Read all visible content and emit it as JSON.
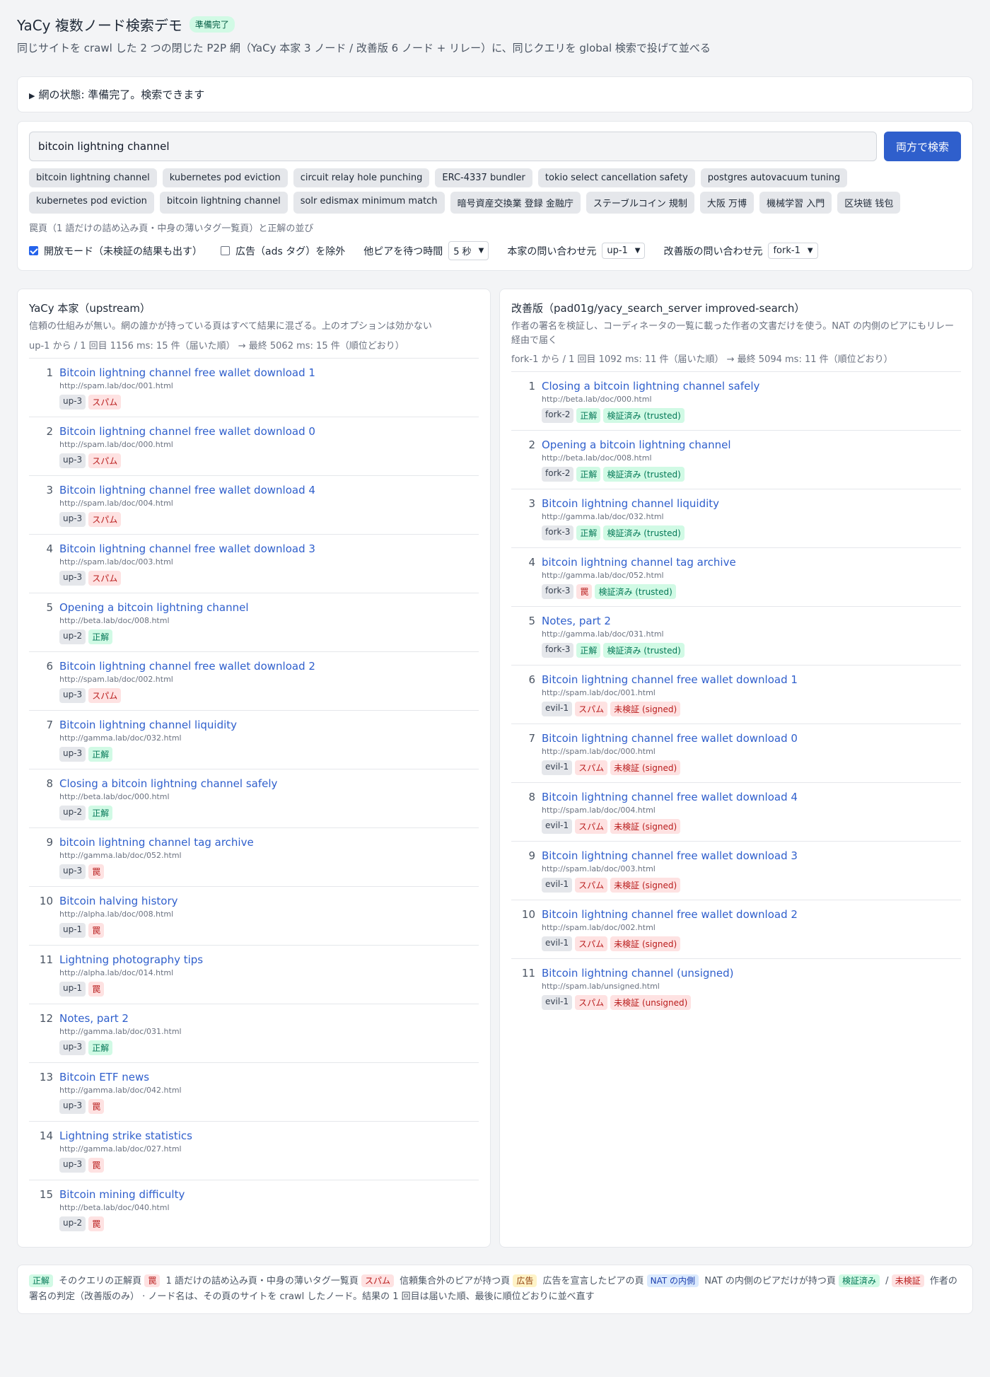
{
  "header": {
    "title": "YaCy 複数ノード検索デモ",
    "ready_badge": "準備完了",
    "subtitle": "同じサイトを crawl した 2 つの閉じた P2P 網（YaCy 本家 3 ノード / 改善版 6 ノード + リレー）に、同じクエリを global 検索で投げて並べる"
  },
  "status": {
    "text": "網の状態: 準備完了。検索できます"
  },
  "search": {
    "value": "bitcoin lightning channel",
    "button": "両方で検索",
    "chips": [
      "bitcoin lightning channel",
      "kubernetes pod eviction",
      "circuit relay hole punching",
      "ERC-4337 bundler",
      "tokio select cancellation safety",
      "postgres autovacuum tuning",
      "kubernetes pod eviction",
      "bitcoin lightning channel",
      "solr edismax minimum match",
      "暗号資産交換業 登録 金融庁",
      "ステーブルコイン 規制",
      "大阪 万博",
      "機械学習 入門",
      "区块链 钱包"
    ],
    "hint": "罠頁（1 語だけの詰め込み頁・中身の薄いタグ一覧頁）と正解の並び",
    "open_mode": "開放モード（未検証の結果も出す）",
    "exclude_ads": "広告（ads タグ）を除外",
    "wait_label": "他ピアを待つ時間",
    "wait_value": "5 秒",
    "upstream_label": "本家の問い合わせ元",
    "upstream_value": "up-1",
    "fork_label": "改善版の問い合わせ元",
    "fork_value": "fork-1"
  },
  "upstream": {
    "title": "YaCy 本家（upstream）",
    "desc": "信頼の仕組みが無い。網の誰かが持っている頁はすべて結果に混ざる。上のオプションは効かない",
    "timing": "up-1 から / 1 回目 1156 ms: 15 件（届いた順） → 最終 5062 ms: 15 件（順位どおり）",
    "results": [
      {
        "rank": "1",
        "title": "Bitcoin lightning channel free wallet download 1",
        "url": "http://spam.lab/doc/001.html",
        "node": "up-3",
        "label": "スパム",
        "kind": "bad"
      },
      {
        "rank": "2",
        "title": "Bitcoin lightning channel free wallet download 0",
        "url": "http://spam.lab/doc/000.html",
        "node": "up-3",
        "label": "スパム",
        "kind": "bad"
      },
      {
        "rank": "3",
        "title": "Bitcoin lightning channel free wallet download 4",
        "url": "http://spam.lab/doc/004.html",
        "node": "up-3",
        "label": "スパム",
        "kind": "bad"
      },
      {
        "rank": "4",
        "title": "Bitcoin lightning channel free wallet download 3",
        "url": "http://spam.lab/doc/003.html",
        "node": "up-3",
        "label": "スパム",
        "kind": "bad"
      },
      {
        "rank": "5",
        "title": "Opening a bitcoin lightning channel",
        "url": "http://beta.lab/doc/008.html",
        "node": "up-2",
        "label": "正解",
        "kind": "ok"
      },
      {
        "rank": "6",
        "title": "Bitcoin lightning channel free wallet download 2",
        "url": "http://spam.lab/doc/002.html",
        "node": "up-3",
        "label": "スパム",
        "kind": "bad"
      },
      {
        "rank": "7",
        "title": "Bitcoin lightning channel liquidity",
        "url": "http://gamma.lab/doc/032.html",
        "node": "up-3",
        "label": "正解",
        "kind": "ok"
      },
      {
        "rank": "8",
        "title": "Closing a bitcoin lightning channel safely",
        "url": "http://beta.lab/doc/000.html",
        "node": "up-2",
        "label": "正解",
        "kind": "ok"
      },
      {
        "rank": "9",
        "title": "bitcoin lightning channel tag archive",
        "url": "http://gamma.lab/doc/052.html",
        "node": "up-3",
        "label": "罠",
        "kind": "bad"
      },
      {
        "rank": "10",
        "title": "Bitcoin halving history",
        "url": "http://alpha.lab/doc/008.html",
        "node": "up-1",
        "label": "罠",
        "kind": "bad"
      },
      {
        "rank": "11",
        "title": "Lightning photography tips",
        "url": "http://alpha.lab/doc/014.html",
        "node": "up-1",
        "label": "罠",
        "kind": "bad"
      },
      {
        "rank": "12",
        "title": "Notes, part 2",
        "url": "http://gamma.lab/doc/031.html",
        "node": "up-3",
        "label": "正解",
        "kind": "ok"
      },
      {
        "rank": "13",
        "title": "Bitcoin ETF news",
        "url": "http://gamma.lab/doc/042.html",
        "node": "up-3",
        "label": "罠",
        "kind": "bad"
      },
      {
        "rank": "14",
        "title": "Lightning strike statistics",
        "url": "http://gamma.lab/doc/027.html",
        "node": "up-3",
        "label": "罠",
        "kind": "bad"
      },
      {
        "rank": "15",
        "title": "Bitcoin mining difficulty",
        "url": "http://beta.lab/doc/040.html",
        "node": "up-2",
        "label": "罠",
        "kind": "bad"
      }
    ]
  },
  "fork": {
    "title": "改善版（pad01g/yacy_search_server improved-search）",
    "desc": "作者の署名を検証し、コーディネータの一覧に載った作者の文書だけを使う。NAT の内側のピアにもリレー経由で届く",
    "timing": "fork-1 から / 1 回目 1092 ms: 11 件（届いた順） → 最終 5094 ms: 11 件（順位どおり）",
    "results": [
      {
        "rank": "1",
        "title": "Closing a bitcoin lightning channel safely",
        "url": "http://beta.lab/doc/000.html",
        "node": "fork-2",
        "label": "正解",
        "kind": "ok",
        "verify": "検証済み (trusted)",
        "vkind": "ok"
      },
      {
        "rank": "2",
        "title": "Opening a bitcoin lightning channel",
        "url": "http://beta.lab/doc/008.html",
        "node": "fork-2",
        "label": "正解",
        "kind": "ok",
        "verify": "検証済み (trusted)",
        "vkind": "ok"
      },
      {
        "rank": "3",
        "title": "Bitcoin lightning channel liquidity",
        "url": "http://gamma.lab/doc/032.html",
        "node": "fork-3",
        "label": "正解",
        "kind": "ok",
        "verify": "検証済み (trusted)",
        "vkind": "ok"
      },
      {
        "rank": "4",
        "title": "bitcoin lightning channel tag archive",
        "url": "http://gamma.lab/doc/052.html",
        "node": "fork-3",
        "label": "罠",
        "kind": "bad",
        "verify": "検証済み (trusted)",
        "vkind": "ok"
      },
      {
        "rank": "5",
        "title": "Notes, part 2",
        "url": "http://gamma.lab/doc/031.html",
        "node": "fork-3",
        "label": "正解",
        "kind": "ok",
        "verify": "検証済み (trusted)",
        "vkind": "ok"
      },
      {
        "rank": "6",
        "title": "Bitcoin lightning channel free wallet download 1",
        "url": "http://spam.lab/doc/001.html",
        "node": "evil-1",
        "label": "スパム",
        "kind": "bad",
        "verify": "未検証 (signed)",
        "vkind": "bad"
      },
      {
        "rank": "7",
        "title": "Bitcoin lightning channel free wallet download 0",
        "url": "http://spam.lab/doc/000.html",
        "node": "evil-1",
        "label": "スパム",
        "kind": "bad",
        "verify": "未検証 (signed)",
        "vkind": "bad"
      },
      {
        "rank": "8",
        "title": "Bitcoin lightning channel free wallet download 4",
        "url": "http://spam.lab/doc/004.html",
        "node": "evil-1",
        "label": "スパム",
        "kind": "bad",
        "verify": "未検証 (signed)",
        "vkind": "bad"
      },
      {
        "rank": "9",
        "title": "Bitcoin lightning channel free wallet download 3",
        "url": "http://spam.lab/doc/003.html",
        "node": "evil-1",
        "label": "スパム",
        "kind": "bad",
        "verify": "未検証 (signed)",
        "vkind": "bad"
      },
      {
        "rank": "10",
        "title": "Bitcoin lightning channel free wallet download 2",
        "url": "http://spam.lab/doc/002.html",
        "node": "evil-1",
        "label": "スパム",
        "kind": "bad",
        "verify": "未検証 (signed)",
        "vkind": "bad"
      },
      {
        "rank": "11",
        "title": "Bitcoin lightning channel (unsigned)",
        "url": "http://spam.lab/unsigned.html",
        "node": "evil-1",
        "label": "スパム",
        "kind": "bad",
        "verify": "未検証 (unsigned)",
        "vkind": "bad"
      }
    ]
  },
  "legend": {
    "ok": "正解",
    "ok_desc": "そのクエリの正解頁",
    "trap": "罠",
    "trap_desc": "1 語だけの詰め込み頁・中身の薄いタグ一覧頁",
    "spam": "スパム",
    "spam_desc": "信頼集合外のピアが持つ頁",
    "ad": "広告",
    "ad_desc": "広告を宣言したピアの頁",
    "nat": "NAT の内側",
    "nat_desc": "NAT の内側のピアだけが持つ頁",
    "verified": "検証済み",
    "slash": "/",
    "unverified": "未検証",
    "tail": "作者の署名の判定（改善版のみ） · ノード名は、その頁のサイトを crawl したノード。結果の 1 回目は届いた順、最後に順位どおりに並べ直す"
  },
  "colors": {
    "accent": "#2f5fcc",
    "ok_bg": "#d1fae5",
    "bad_bg": "#fee2e2",
    "ad_bg": "#fef3c7",
    "nat_bg": "#dbeafe"
  }
}
